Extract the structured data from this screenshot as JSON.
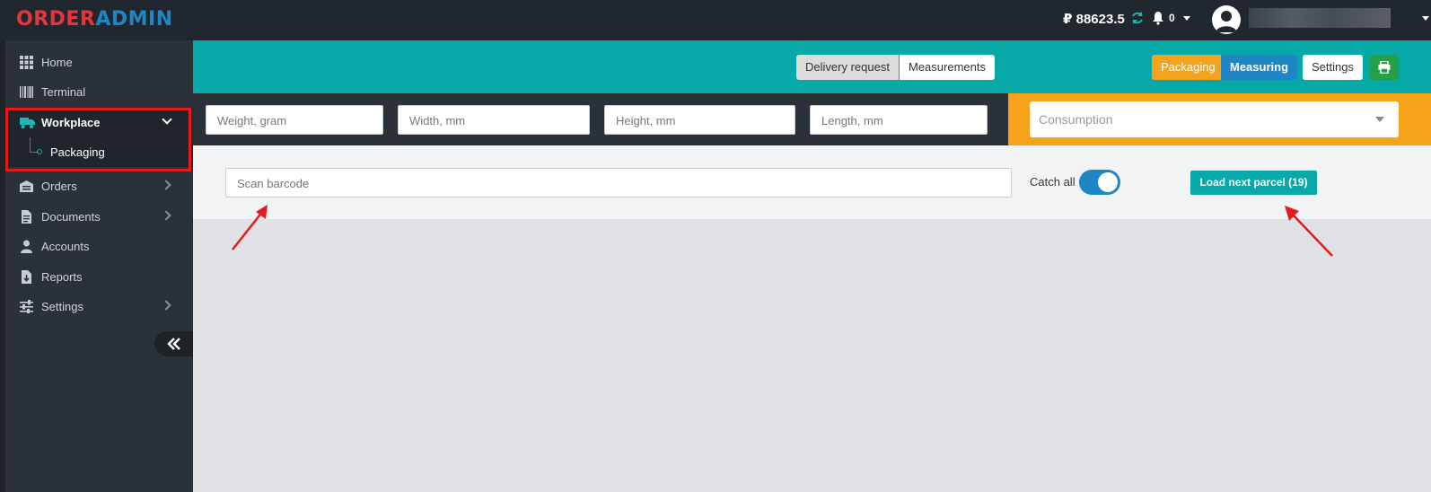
{
  "app": {
    "logo_part1": "ORDER",
    "logo_part2": "ADMIN"
  },
  "header": {
    "balance": "₽ 88623.5",
    "notifications_count": "0"
  },
  "sidebar": {
    "items": [
      {
        "label": "Home",
        "icon": "grid-icon"
      },
      {
        "label": "Terminal",
        "icon": "barcode-icon"
      },
      {
        "label": "Workplace",
        "icon": "truck-icon",
        "expanded": true
      },
      {
        "label": "Packaging",
        "sub": true,
        "active": true
      },
      {
        "label": "Orders",
        "icon": "warehouse-icon",
        "has_children": true
      },
      {
        "label": "Documents",
        "icon": "document-icon",
        "has_children": true
      },
      {
        "label": "Accounts",
        "icon": "user-icon"
      },
      {
        "label": "Reports",
        "icon": "download-file-icon"
      },
      {
        "label": "Settings",
        "icon": "sliders-icon",
        "has_children": true
      }
    ]
  },
  "toolbar": {
    "segment_delivery": "Delivery request",
    "segment_measurements": "Measurements",
    "btn_packaging": "Packaging",
    "btn_measuring": "Measuring",
    "btn_settings": "Settings"
  },
  "measure_fields": {
    "weight_placeholder": "Weight, gram",
    "width_placeholder": "Width, mm",
    "height_placeholder": "Height, mm",
    "length_placeholder": "Length, mm",
    "consumption_placeholder": "Consumption"
  },
  "scan": {
    "placeholder": "Scan barcode",
    "catch_all_label": "Catch all",
    "catch_all_on": true,
    "load_next_label": "Load next parcel (19)"
  },
  "colors": {
    "teal": "#06a8a8",
    "orange": "#f7a21b",
    "blue": "#1f86c6",
    "green": "#24a048",
    "sidebar": "#2b3138",
    "highlight_red": "#e51b1b"
  }
}
